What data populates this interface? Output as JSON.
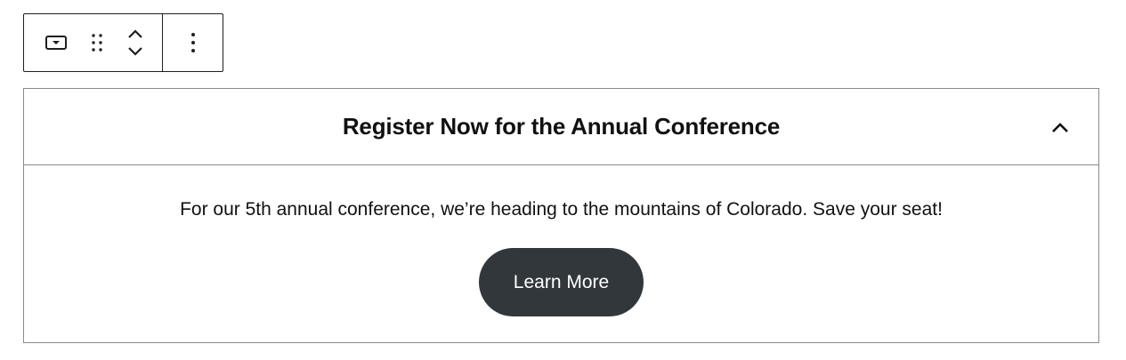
{
  "toolbar": {
    "block_type_icon": "accordion-block-icon",
    "drag_icon": "drag-handle-icon",
    "move_up_icon": "chevron-up-icon",
    "move_down_icon": "chevron-down-icon",
    "more_icon": "more-vertical-icon"
  },
  "accordion": {
    "title": "Register Now for the Annual Conference",
    "toggle_icon": "chevron-up-icon",
    "body_text": "For our 5th annual conference, we’re heading to the mountains of Colorado. Save your seat!",
    "button_label": "Learn More",
    "button_color": "#32373c",
    "button_text_color": "#ffffff"
  }
}
